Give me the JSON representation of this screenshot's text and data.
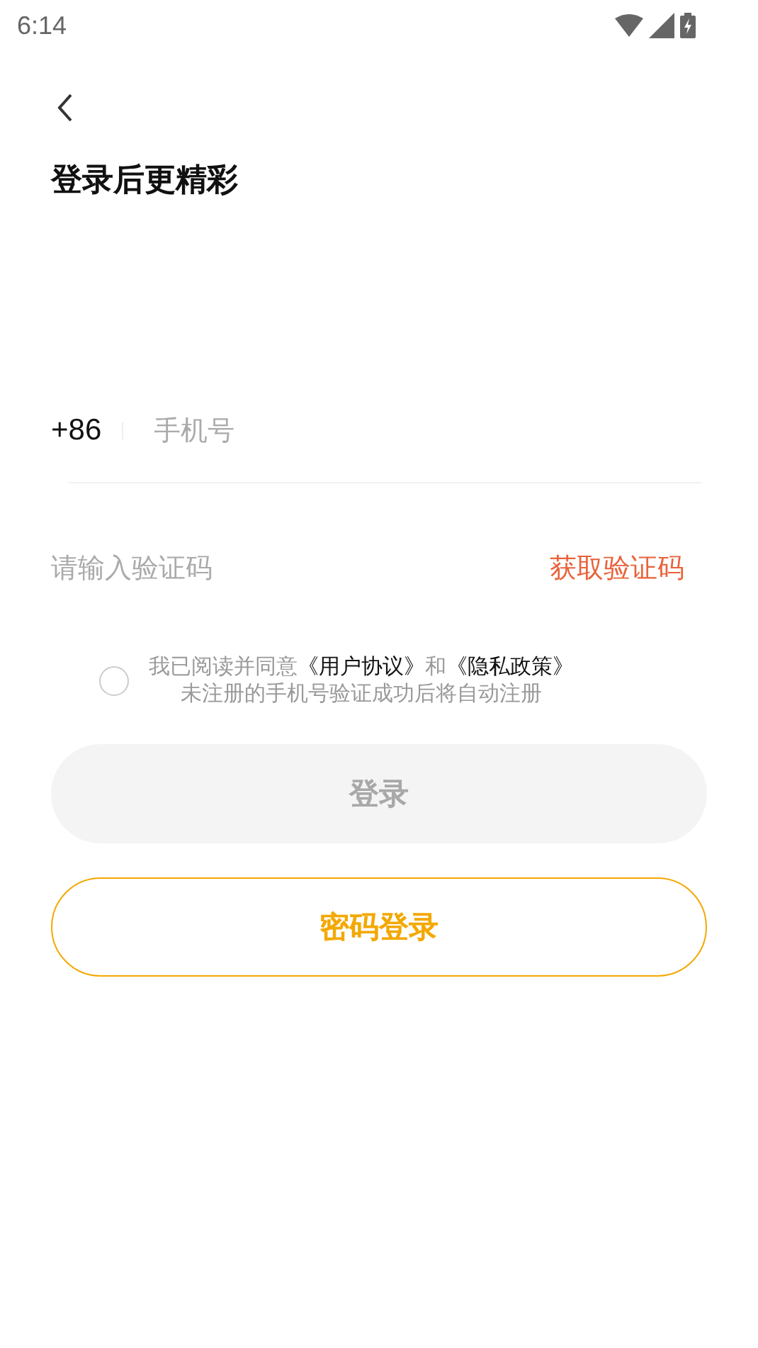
{
  "status_bar": {
    "time": "6:14"
  },
  "title": "登录后更精彩",
  "phone": {
    "country_code": "+86",
    "placeholder": "手机号"
  },
  "code": {
    "placeholder": "请输入验证码",
    "action": "获取验证码"
  },
  "agreement": {
    "checked": false,
    "parts": [
      {
        "kind": "text",
        "text": "我已阅读并同意"
      },
      {
        "kind": "link",
        "text": "《用户协议》"
      },
      {
        "kind": "text",
        "text": "和"
      },
      {
        "kind": "link",
        "text": "《隐私政策》"
      }
    ],
    "note": "未注册的手机号验证成功后将自动注册"
  },
  "buttons": [
    {
      "kind": "filled",
      "label": "登录",
      "disabled": true
    },
    {
      "kind": "outline",
      "label": "密码登录",
      "disabled": false
    }
  ]
}
